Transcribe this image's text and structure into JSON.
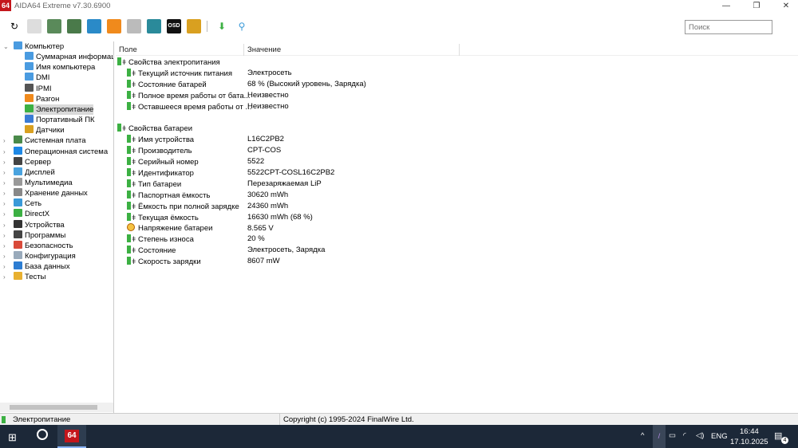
{
  "window": {
    "logo": "64",
    "title": "AIDA64 Extreme v7.30.6900",
    "min": "—",
    "max": "❐",
    "close": "✕"
  },
  "toolbar": {
    "icons": [
      "refresh-icon",
      "report-icon",
      "motherboard-icon",
      "memory-icon",
      "network-icon",
      "overclock-icon",
      "config-icon",
      "user-icon",
      "osd-icon",
      "gauge-icon",
      "download-icon",
      "search-icon"
    ],
    "osd_label": "OSD",
    "search_placeholder": "Поиск"
  },
  "tree": [
    {
      "label": "Компьютер",
      "level": 0,
      "expanded": true,
      "icon": "monitor-icon",
      "color": "#4a9be0"
    },
    {
      "label": "Суммарная информация",
      "level": 1,
      "icon": "monitor-icon",
      "color": "#4a9be0"
    },
    {
      "label": "Имя компьютера",
      "level": 1,
      "icon": "monitor-icon",
      "color": "#4a9be0"
    },
    {
      "label": "DMI",
      "level": 1,
      "icon": "monitor-icon",
      "color": "#4a9be0"
    },
    {
      "label": "IPMI",
      "level": 1,
      "icon": "server-icon",
      "color": "#555"
    },
    {
      "label": "Разгон",
      "level": 1,
      "icon": "flame-icon",
      "color": "#f08a1c"
    },
    {
      "label": "Электропитание",
      "level": 1,
      "icon": "battery-icon",
      "color": "#3cb043",
      "selected": true
    },
    {
      "label": "Портативный ПК",
      "level": 1,
      "icon": "laptop-icon",
      "color": "#3a7bd5"
    },
    {
      "label": "Датчики",
      "level": 1,
      "icon": "gauge-icon",
      "color": "#d9a020"
    },
    {
      "label": "Системная плата",
      "level": 0,
      "icon": "motherboard-icon",
      "color": "#4a8a4a"
    },
    {
      "label": "Операционная система",
      "level": 0,
      "icon": "windows-icon",
      "color": "#1e88e5"
    },
    {
      "label": "Сервер",
      "level": 0,
      "icon": "server-icon",
      "color": "#444"
    },
    {
      "label": "Дисплей",
      "level": 0,
      "icon": "display-icon",
      "color": "#4aa3df"
    },
    {
      "label": "Мультимедиа",
      "level": 0,
      "icon": "speaker-icon",
      "color": "#999"
    },
    {
      "label": "Хранение данных",
      "level": 0,
      "icon": "storage-icon",
      "color": "#888"
    },
    {
      "label": "Сеть",
      "level": 0,
      "icon": "network-icon",
      "color": "#3a9ad9"
    },
    {
      "label": "DirectX",
      "level": 0,
      "icon": "xbox-icon",
      "color": "#3cb043"
    },
    {
      "label": "Устройства",
      "level": 0,
      "icon": "device-icon",
      "color": "#333"
    },
    {
      "label": "Программы",
      "level": 0,
      "icon": "programs-icon",
      "color": "#444"
    },
    {
      "label": "Безопасность",
      "level": 0,
      "icon": "shield-icon",
      "color": "#d94a3a"
    },
    {
      "label": "Конфигурация",
      "level": 0,
      "icon": "config-icon",
      "color": "#9ab"
    },
    {
      "label": "База данных",
      "level": 0,
      "icon": "database-icon",
      "color": "#2d7dd2"
    },
    {
      "label": "Тесты",
      "level": 0,
      "icon": "tests-icon",
      "color": "#e8b030"
    }
  ],
  "list": {
    "col_field": "Поле",
    "col_value": "Значение",
    "rows": [
      {
        "field": "Свойства электропитания",
        "section": true
      },
      {
        "field": "Текущий источник питания",
        "value": "Электросеть"
      },
      {
        "field": "Состояние батарей",
        "value": "68 % (Высокий уровень, Зарядка)"
      },
      {
        "field": "Полное время работы от бата...",
        "value": "Неизвестно"
      },
      {
        "field": "Оставшееся время работы от ...",
        "value": "Неизвестно"
      },
      {
        "blank": true
      },
      {
        "field": "Свойства батареи",
        "section": true
      },
      {
        "field": "Имя устройства",
        "value": "L16C2PB2"
      },
      {
        "field": "Производитель",
        "value": "CPT-COS"
      },
      {
        "field": "Серийный номер",
        "value": "5522"
      },
      {
        "field": "Идентификатор",
        "value": "5522CPT-COSL16C2PB2"
      },
      {
        "field": "Тип батареи",
        "value": "Перезаряжаемая LiP"
      },
      {
        "field": "Паспортная ёмкость",
        "value": "30620 mWh"
      },
      {
        "field": "Ёмкость при полной зарядке",
        "value": "24360 mWh"
      },
      {
        "field": "Текущая ёмкость",
        "value": "16630 mWh  (68 %)"
      },
      {
        "field": "Напряжение батареи",
        "value": "8.565 V",
        "icon": "voltage-icon"
      },
      {
        "field": "Степень износа",
        "value": "20 %"
      },
      {
        "field": "Состояние",
        "value": "Электросеть, Зарядка"
      },
      {
        "field": "Скорость зарядки",
        "value": "8607 mW"
      }
    ]
  },
  "status": {
    "left": "Электропитание",
    "center": "Copyright (c) 1995-2024 FinalWire Ltd."
  },
  "taskbar": {
    "app_label": "64",
    "lang": "ENG",
    "time": "16:44",
    "date": "17.10.2025",
    "notifications": "4"
  }
}
